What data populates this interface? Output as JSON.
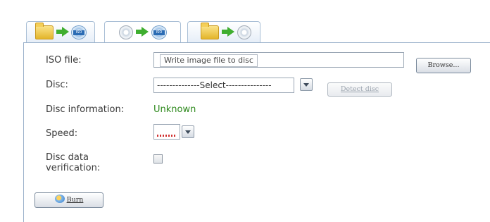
{
  "tabs": [
    {
      "name": "image-to-disc",
      "active": false
    },
    {
      "name": "disc-to-disc",
      "active": true
    },
    {
      "name": "folder-to-disc",
      "active": false
    }
  ],
  "tab_icons": {
    "tab1": [
      "folder-icon",
      "arrow-right-icon",
      "disc-image-icon"
    ],
    "tab2": [
      "disc-icon",
      "arrow-right-icon",
      "disc-image-icon"
    ],
    "tab3": [
      "folder-icon",
      "arrow-right-icon",
      "disc-icon"
    ],
    "disc_image_badge": "ISO"
  },
  "form": {
    "iso_file_label": "ISO file:",
    "iso_file_value": "Write image file to disc",
    "browse_label": "Browse...",
    "disc_label": "Disc:",
    "disc_select_value": "--------------Select---------------",
    "detect_disc_label": "Detect disc",
    "disc_info_label": "Disc information:",
    "disc_info_value": "Unknown",
    "speed_label": "Speed:",
    "verify_label_line1": "Disc data",
    "verify_label_line2": "verification:",
    "verify_checked": false,
    "burn_label": "Burn"
  },
  "colors": {
    "accent_border": "#9db3cc",
    "status_unknown": "#2f8a1e",
    "arrow_green": "#3fae2f"
  }
}
